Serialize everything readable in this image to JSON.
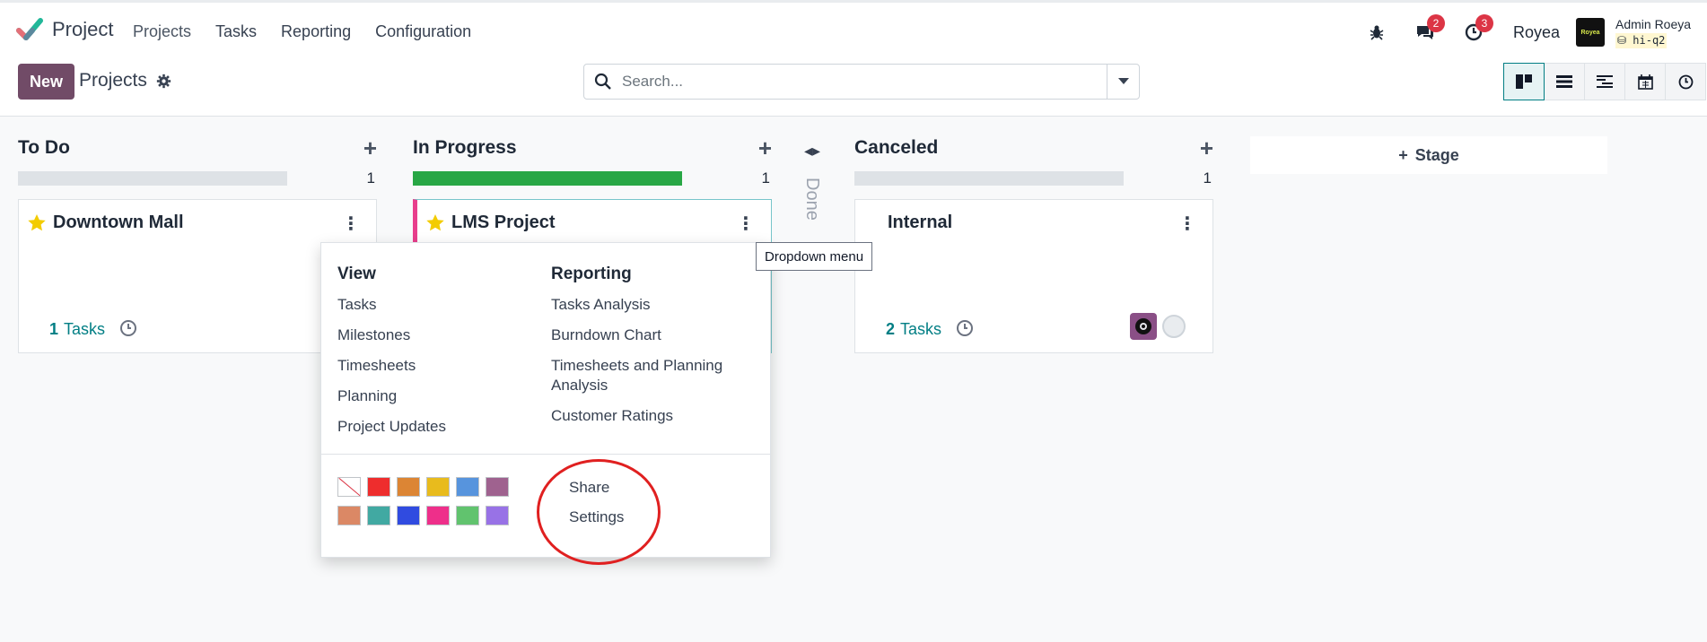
{
  "app": {
    "name": "Project"
  },
  "nav": [
    "Projects",
    "Tasks",
    "Reporting",
    "Configuration"
  ],
  "systray": {
    "messages_badge": "2",
    "activities_badge": "3",
    "company": "Royea",
    "user_name": "Admin Roeya",
    "db_name": "hi-q2",
    "avatar_text": "Royea"
  },
  "control": {
    "new_label": "New",
    "title": "Projects",
    "search_placeholder": "Search..."
  },
  "columns": [
    {
      "title": "To Do",
      "count": "1",
      "progress": 0,
      "card": {
        "name": "Downtown Mall",
        "tasks_count": "1",
        "tasks_label": "Tasks",
        "favorite": true
      }
    },
    {
      "title": "In Progress",
      "count": "1",
      "progress": 1.0,
      "card": {
        "name": "LMS Project",
        "favorite": true
      }
    },
    {
      "title": "Canceled",
      "count": "1",
      "progress": 0,
      "card": {
        "name": "Internal",
        "tasks_count": "2",
        "tasks_label": "Tasks",
        "favorite": false
      }
    }
  ],
  "folded_column": {
    "label": "Done"
  },
  "add_stage_label": "Stage",
  "tooltip": "Dropdown menu",
  "dropdown": {
    "view_title": "View",
    "view_items": [
      "Tasks",
      "Milestones",
      "Timesheets",
      "Planning",
      "Project Updates"
    ],
    "reporting_title": "Reporting",
    "reporting_items": [
      "Tasks Analysis",
      "Burndown Chart",
      "Timesheets and Planning Analysis",
      "Customer Ratings"
    ],
    "actions": [
      "Share",
      "Settings"
    ],
    "colors": [
      "none",
      "#ee2d2d",
      "#dc8534",
      "#e8bb1d",
      "#5794dd",
      "#9f628f",
      "#db8865",
      "#41a9a2",
      "#304be0",
      "#ee2f8a",
      "#61c36e",
      "#9872e6"
    ]
  },
  "colors": {
    "brand": "#714b67",
    "link": "#017e84",
    "progress": "#28a745",
    "annotation": "#e02020"
  }
}
